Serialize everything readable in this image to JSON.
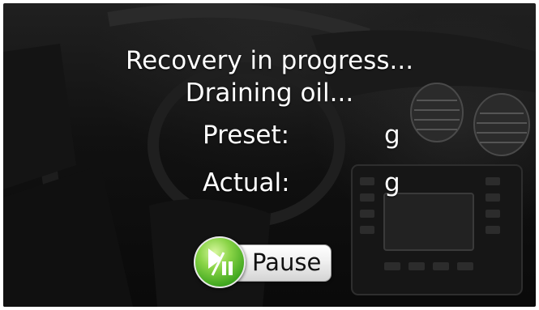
{
  "screen": {
    "title": "Recovery in progress...",
    "status": "Draining oil..."
  },
  "readings": {
    "preset_label": "Preset:",
    "preset_unit": "g",
    "actual_label": "Actual:",
    "actual_unit": "g"
  },
  "controls": {
    "pause_label": "Pause",
    "pause_icon": "play-pause-icon"
  },
  "colors": {
    "text": "#ffffff",
    "button_green": "#4cb52a"
  }
}
